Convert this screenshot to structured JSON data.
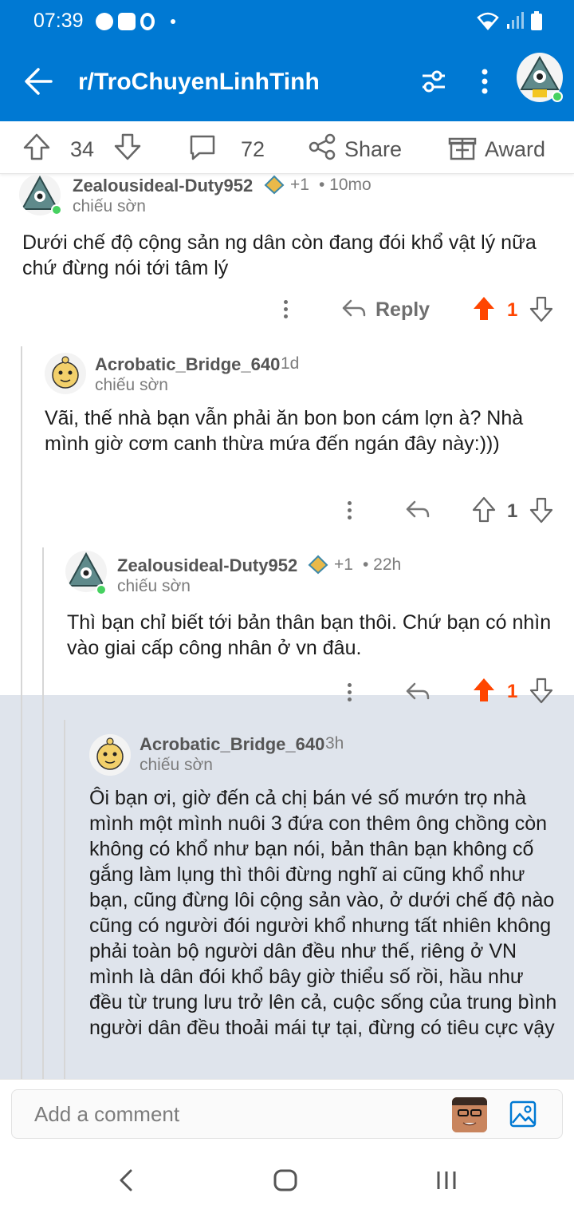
{
  "status": {
    "time": "07:39"
  },
  "header": {
    "subreddit": "r/TroChuyenLinhTinh"
  },
  "post_bar": {
    "upvotes": "34",
    "comments": "72",
    "share": "Share",
    "award": "Award"
  },
  "comments": [
    {
      "username": "Zealousideal-Duty952",
      "flair_score": "+1",
      "age": "• 10mo",
      "user_flair": "chiếu sờn",
      "body": "Dưới chế độ cộng sản ng dân còn đang đói khổ vật lý nữa chứ đừng nói tới tâm lý",
      "reply": "Reply",
      "score": "1",
      "upvoted": true
    },
    {
      "username": "Acrobatic_Bridge_640",
      "age": "1d",
      "user_flair": "chiếu sờn",
      "body": "Vãi, thế nhà bạn vẫn phải ăn bon bon cám lợn à? Nhà mình giờ cơm canh thừa mứa đến ngán đây này:)))",
      "score": "1",
      "upvoted": false
    },
    {
      "username": "Zealousideal-Duty952",
      "flair_score": "+1",
      "age": "• 22h",
      "user_flair": "chiếu sờn",
      "body": "Thì bạn chỉ biết tới bản thân bạn thôi. Chứ bạn có nhìn vào giai cấp công nhân ở vn đâu.",
      "score": "1",
      "upvoted": true
    },
    {
      "username": "Acrobatic_Bridge_640",
      "age": "3h",
      "user_flair": "chiếu sờn",
      "body": "Ôi bạn ơi, giờ đến cả chị bán vé số mướn trọ nhà mình một mình nuôi 3 đứa con thêm ông chồng còn không có khổ như bạn nói, bản thân bạn không cố gắng làm lụng thì thôi đừng nghĩ ai cũng khổ như bạn, cũng đừng lôi cộng sản vào, ở dưới chế độ nào cũng có người đói người khổ nhưng tất nhiên không phải toàn bộ người dân đều như thế, riêng ở VN mình là dân đói khổ bây giờ thiểu số rồi, hầu như đều từ trung lưu trở lên cả, cuộc sống của trung bình người dân đều thoải mái tự tại, đừng có tiêu cực vậy"
    }
  ],
  "comment_input": {
    "placeholder": "Add a comment"
  },
  "colors": {
    "brand_blue": "#0079d3",
    "upvote_orange": "#ff4500",
    "highlight": "#dfe4ec"
  },
  "icons": [
    "back-arrow-icon",
    "filter-icon",
    "more-vertical-icon",
    "upvote-icon",
    "downvote-icon",
    "comment-icon",
    "share-icon",
    "award-icon",
    "reply-icon",
    "image-icon"
  ]
}
